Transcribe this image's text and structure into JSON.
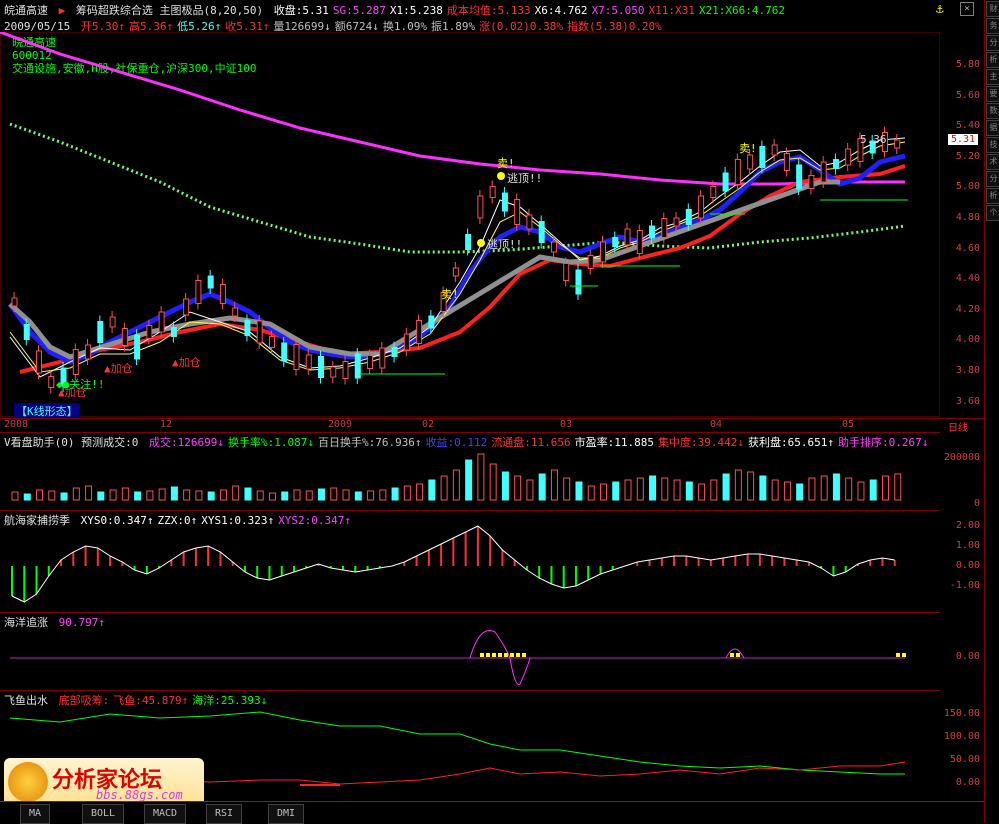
{
  "header": {
    "name": "皖通高速",
    "marker": "▶",
    "indicator": "筹码超跌综合选 主图极品(8,20,50)",
    "items": [
      {
        "t": "收盘:5.31",
        "c": "#ffffff"
      },
      {
        "t": "SG:5.287",
        "c": "#ff40ff"
      },
      {
        "t": "X1:5.238",
        "c": "#ffffff"
      },
      {
        "t": "成本均值:5.133",
        "c": "#ff3030"
      },
      {
        "t": "X6:4.762",
        "c": "#ffffff"
      },
      {
        "t": "X7:5.050",
        "c": "#ff40ff"
      },
      {
        "t": "X11:X31",
        "c": "#ff3030"
      },
      {
        "t": "X21:X66:4.762",
        "c": "#00ff00"
      }
    ]
  },
  "quote_line": {
    "date": "2009/05/15",
    "items": [
      {
        "t": "开5.30↑",
        "c": "#ff3030"
      },
      {
        "t": "高5.36↑",
        "c": "#ff3030"
      },
      {
        "t": "低5.26↑",
        "c": "#40ffff"
      },
      {
        "t": "收5.31↑",
        "c": "#ff3030"
      },
      {
        "t": "量126699↓",
        "c": "#c0c0c0"
      },
      {
        "t": "额6724↓",
        "c": "#c0c0c0"
      },
      {
        "t": "换1.09%",
        "c": "#c0c0c0"
      },
      {
        "t": "振1.89%",
        "c": "#c0c0c0"
      },
      {
        "t": "涨(0.02)0.38%",
        "c": "#ff3030"
      },
      {
        "t": "指数(5.38)0.20%",
        "c": "#ff3030"
      }
    ]
  },
  "stock_info": {
    "line1": "皖通高速",
    "line2": "600012",
    "line3": "交通设施,安徽,H股,社保重仓,沪深300,中证100"
  },
  "main_axis": [
    "5.80",
    "5.60",
    "5.40",
    "5.20",
    "5.00",
    "4.80",
    "4.60",
    "4.40",
    "4.20",
    "4.00",
    "3.80",
    "3.60"
  ],
  "price_tag": "5.31",
  "price_peak": "5.36",
  "x_labels": [
    "2008",
    "12",
    "2009",
    "02",
    "03",
    "04",
    "05",
    "日线"
  ],
  "annotations": {
    "sell1": "卖!",
    "sell2": "卖!",
    "sell3": "卖!",
    "escape1": "逃顶!!",
    "escape2": "逃顶!!",
    "add1": "加仓",
    "add2": "加仓",
    "add3": "加仓",
    "watch": "关注!!",
    "kline": "【K线形态】"
  },
  "vol_panel": {
    "title": "V看盘助手(0) 预测成交:0",
    "items": [
      {
        "t": "成交:126699↓",
        "c": "#ff40ff"
      },
      {
        "t": "换手率%:1.087↓",
        "c": "#00ff00"
      },
      {
        "t": "百日换手%:76.936↑",
        "c": "#c0c0c0"
      },
      {
        "t": "收益:0.112",
        "c": "#4040ff"
      },
      {
        "t": "流通盘:11.656",
        "c": "#ff3030"
      },
      {
        "t": "市盈率:11.885",
        "c": "#ffffff"
      },
      {
        "t": "集中度:39.442↓",
        "c": "#ff3030"
      },
      {
        "t": "获利盘:65.651↑",
        "c": "#ffffff"
      },
      {
        "t": "助手排序:0.267↓",
        "c": "#ff40ff"
      }
    ],
    "axis": [
      "200000",
      "0"
    ]
  },
  "osc_panel": {
    "title": "航海家捕捞季",
    "items": [
      {
        "t": "XYS0:0.347↑",
        "c": "#ffffff"
      },
      {
        "t": "ZZX:0↑",
        "c": "#ffffff"
      },
      {
        "t": "XYS1:0.323↑",
        "c": "#ffffff"
      },
      {
        "t": "XYS2:0.347↑",
        "c": "#ff40ff"
      }
    ],
    "axis": [
      "2.00",
      "1.00",
      "0.00",
      "-1.00"
    ]
  },
  "sea_panel": {
    "title": "海洋追涨",
    "value": "90.797↑",
    "axis": [
      "0.00"
    ]
  },
  "fish_panel": {
    "title": "飞鱼出水",
    "items": [
      {
        "t": "底部吸筹:",
        "c": "#ff3030"
      },
      {
        "t": "飞鱼:45.879↑",
        "c": "#ff3030"
      },
      {
        "t": "海洋:25.393↓",
        "c": "#00ff00"
      }
    ],
    "axis": [
      "150.00",
      "100.00",
      "50.00",
      "0.00"
    ]
  },
  "bottom_tabs": [
    "MA",
    "BOLL",
    "MACD",
    "RSI",
    "DMI"
  ],
  "logo": {
    "title": "分析家论坛",
    "url": "bbs.88gs.com"
  },
  "sidebar_tabs": [
    "财",
    "务",
    "分",
    "析",
    "主",
    "要",
    "数",
    "据",
    "技",
    "术",
    "分",
    "析",
    "个"
  ]
}
